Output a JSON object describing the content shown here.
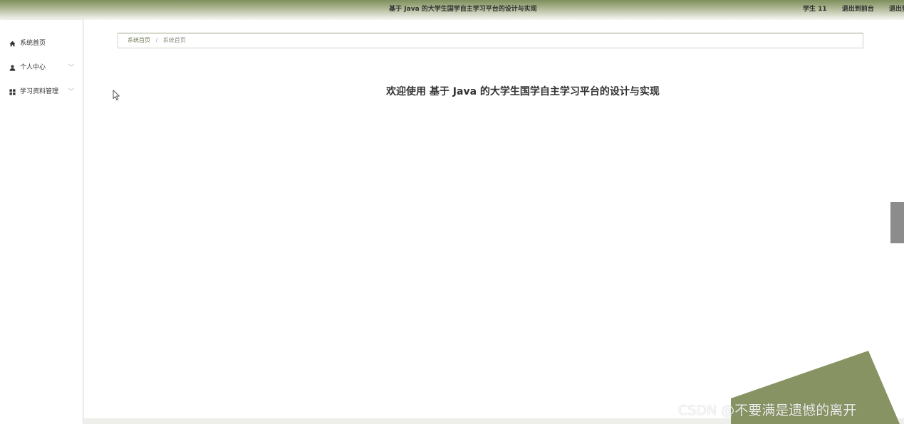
{
  "header": {
    "title": "基于 Java 的大学生国学自主学习平台的设计与实现",
    "user": "学生 11",
    "back_to_front": "退出到前台",
    "logout": "退出登录"
  },
  "sidebar": {
    "items": [
      {
        "label": "系统首页",
        "icon": "home-icon",
        "has_chevron": false
      },
      {
        "label": "个人中心",
        "icon": "user-icon",
        "has_chevron": true
      },
      {
        "label": "学习资料管理",
        "icon": "grid-icon",
        "has_chevron": true
      }
    ],
    "chevron_glyph": "﹀"
  },
  "breadcrumb": {
    "home": "系统首页",
    "separator": "/",
    "current": "系统首页"
  },
  "main": {
    "welcome": "欢迎使用 基于 Java 的大学生国学自主学习平台的设计与实现"
  },
  "watermark": "CSDN @不要满是遗憾的离开",
  "colors": {
    "accent": "#8a9868",
    "header_gradient_top": "#7e8f5c",
    "deco_shape": "#879363",
    "scroll_handle": "#8c8c8c"
  }
}
